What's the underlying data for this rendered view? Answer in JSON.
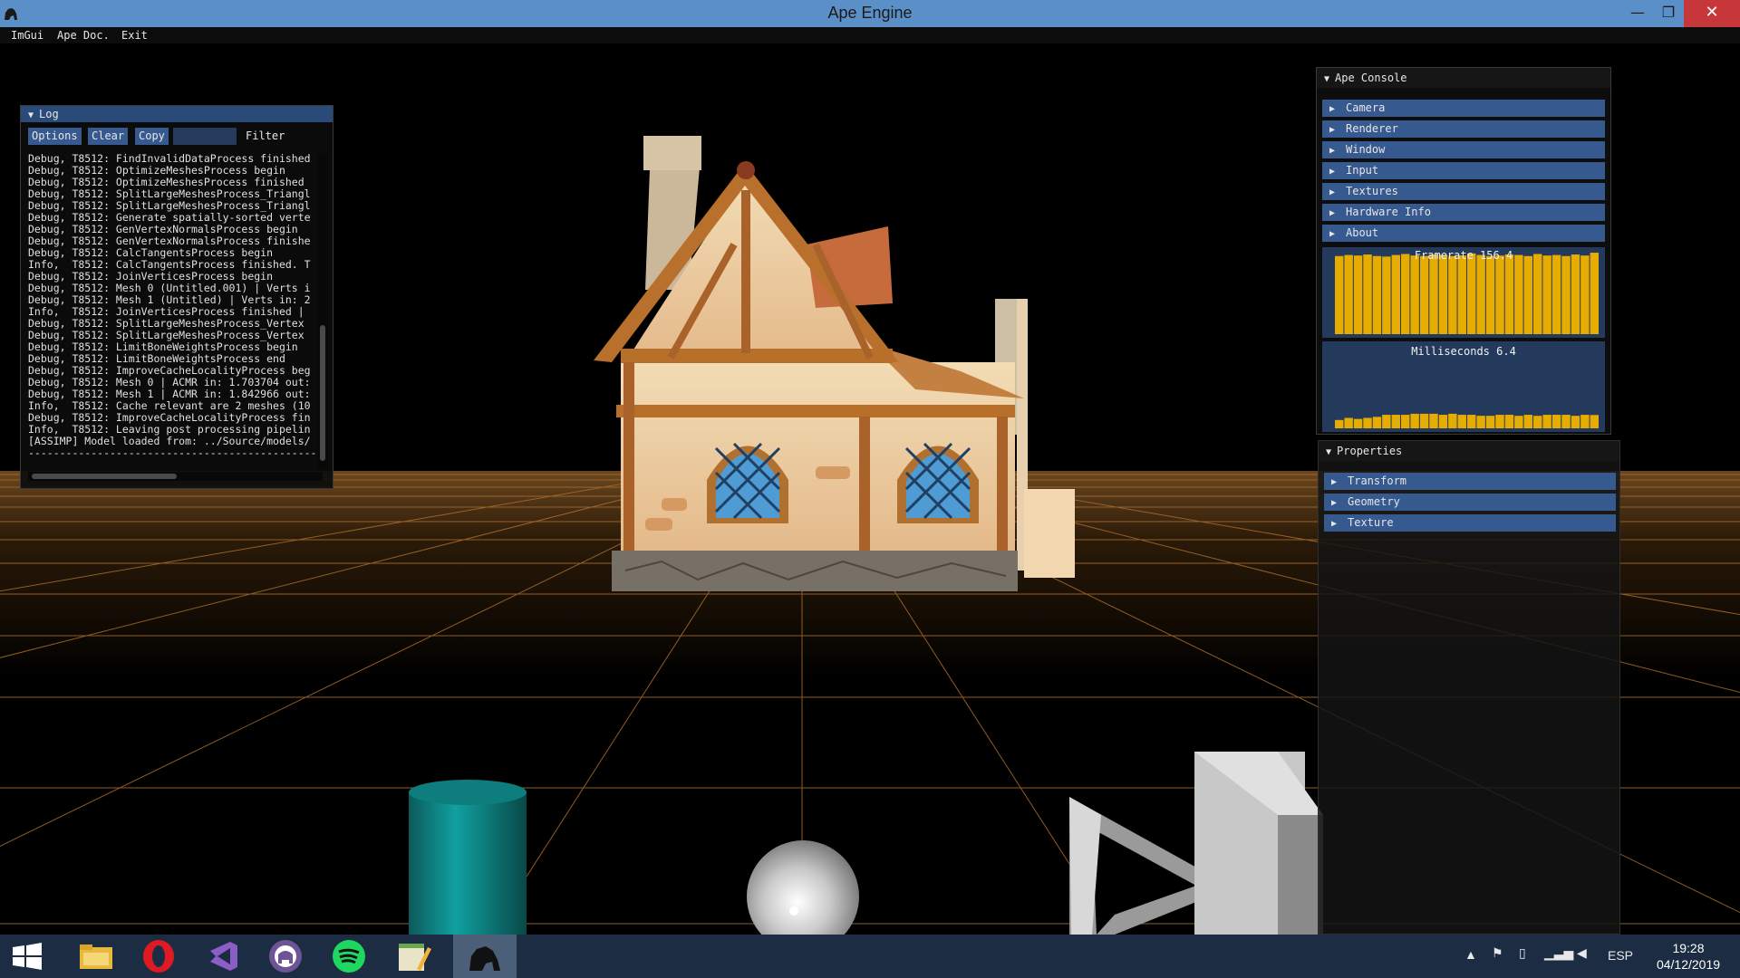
{
  "window": {
    "title": "Ape Engine",
    "minimize_glyph": "—",
    "maximize_glyph": "❐",
    "close_glyph": "✕"
  },
  "menu": {
    "items": [
      "ImGui",
      "Ape Doc.",
      "Exit"
    ]
  },
  "log": {
    "title": "Log",
    "buttons": [
      "Options",
      "Clear",
      "Copy"
    ],
    "filter_value": "",
    "filter_label": "Filter",
    "lines": [
      "Debug, T8512: FindInvalidDataProcess finished",
      "Debug, T8512: OptimizeMeshesProcess begin",
      "Debug, T8512: OptimizeMeshesProcess finished",
      "Debug, T8512: SplitLargeMeshesProcess_Triangl",
      "Debug, T8512: SplitLargeMeshesProcess_Triangl",
      "Debug, T8512: Generate spatially-sorted verte",
      "Debug, T8512: GenVertexNormalsProcess begin",
      "Debug, T8512: GenVertexNormalsProcess finishe",
      "Debug, T8512: CalcTangentsProcess begin",
      "Info,  T8512: CalcTangentsProcess finished. T",
      "Debug, T8512: JoinVerticesProcess begin",
      "Debug, T8512: Mesh 0 (Untitled.001) | Verts i",
      "Debug, T8512: Mesh 1 (Untitled) | Verts in: 2",
      "Info,  T8512: JoinVerticesProcess finished |",
      "Debug, T8512: SplitLargeMeshesProcess_Vertex",
      "Debug, T8512: SplitLargeMeshesProcess_Vertex",
      "Debug, T8512: LimitBoneWeightsProcess begin",
      "Debug, T8512: LimitBoneWeightsProcess end",
      "Debug, T8512: ImproveCacheLocalityProcess beg",
      "Debug, T8512: Mesh 0 | ACMR in: 1.703704 out:",
      "Debug, T8512: Mesh 1 | ACMR in: 1.842966 out:",
      "Info,  T8512: Cache relevant are 2 meshes (10",
      "Debug, T8512: ImproveCacheLocalityProcess fin",
      "Info,  T8512: Leaving post processing pipelin",
      "[ASSIMP] Model loaded from: ../Source/models/",
      "----------------------------------------------"
    ]
  },
  "console": {
    "title": "Ape Console",
    "headers": [
      "Camera",
      "Renderer",
      "Window",
      "Input",
      "Textures",
      "Hardware Info",
      "About"
    ],
    "framerate_label": "Framerate 156.4",
    "milliseconds_label": "Milliseconds 6.4",
    "framerate_history": [
      150,
      152,
      151,
      153,
      150,
      149,
      152,
      154,
      151,
      150,
      153,
      152,
      150,
      151,
      155,
      152,
      150,
      151,
      153,
      152,
      150,
      154,
      151,
      152,
      150,
      153,
      151,
      156.4
    ],
    "framerate_max": 160,
    "ms_history": [
      4.0,
      5.0,
      4.5,
      5.0,
      5.5,
      6.5,
      6.5,
      6.5,
      7.0,
      7.0,
      7.0,
      6.5,
      7.0,
      6.5,
      6.5,
      6.0,
      6.0,
      6.5,
      6.5,
      6.0,
      6.5,
      6.0,
      6.5,
      6.5,
      6.5,
      6.0,
      6.5,
      6.4
    ],
    "ms_max": 40,
    "bar_color": "#e6ac00"
  },
  "properties": {
    "title": "Properties",
    "headers": [
      "Transform",
      "Geometry",
      "Texture"
    ]
  },
  "taskbar": {
    "apps": [
      "windows-start",
      "file-explorer",
      "opera",
      "visual-studio",
      "github-desktop",
      "spotify",
      "notepad-plus-plus",
      "ape-engine"
    ],
    "active_app": "ape-engine",
    "language": "ESP",
    "time": "19:28",
    "date": "04/12/2019"
  },
  "colors": {
    "accent_blue": "#36598f",
    "grid": "#a86b2a",
    "floor_top": "#5a3a17",
    "taskbar": "#1b2c43"
  }
}
